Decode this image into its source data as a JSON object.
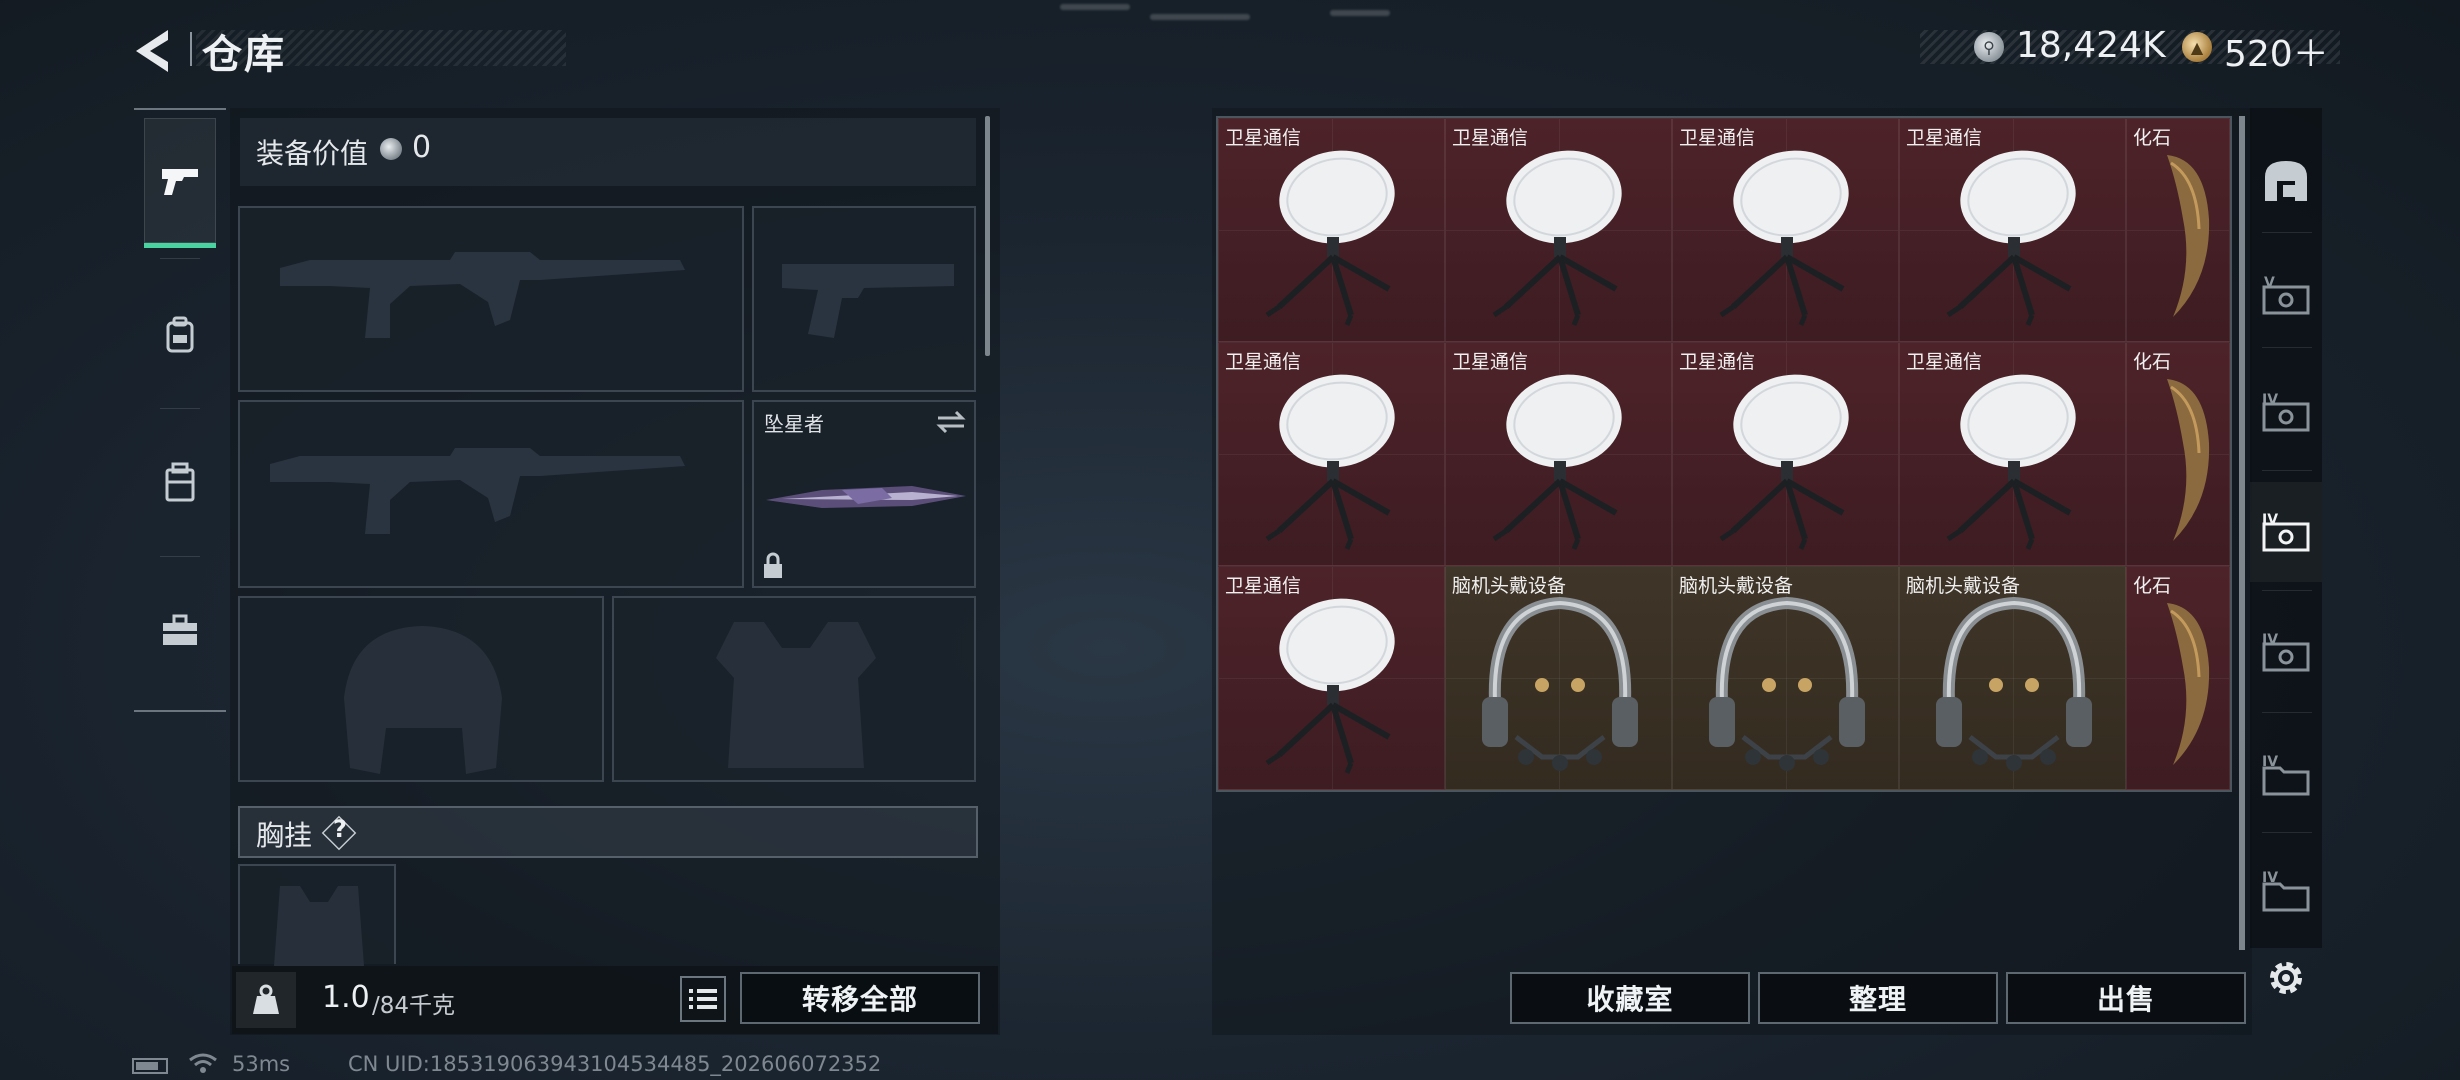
{
  "header": {
    "title": "仓库",
    "currency": {
      "silver_amount": "18,424K",
      "gold_amount": "520＋"
    }
  },
  "loadout": {
    "equip_value_label": "装备价值",
    "equip_value": "0",
    "melee_name": "坠星者",
    "vest_label": "胸挂",
    "vest_help": "?",
    "weight_current": "1.0",
    "weight_max": "/84千克",
    "transfer_all_label": "转移全部"
  },
  "storage": {
    "rows": [
      [
        {
          "name": "卫星通信",
          "type": "dish",
          "tint": "red"
        },
        {
          "name": "卫星通信",
          "type": "dish",
          "tint": "red"
        },
        {
          "name": "卫星通信",
          "type": "dish",
          "tint": "red"
        },
        {
          "name": "卫星通信",
          "type": "dish",
          "tint": "red"
        },
        {
          "name": "化石",
          "type": "claw",
          "tint": "red"
        }
      ],
      [
        {
          "name": "卫星通信",
          "type": "dish",
          "tint": "red"
        },
        {
          "name": "卫星通信",
          "type": "dish",
          "tint": "red"
        },
        {
          "name": "卫星通信",
          "type": "dish",
          "tint": "red"
        },
        {
          "name": "卫星通信",
          "type": "dish",
          "tint": "red"
        },
        {
          "name": "化石",
          "type": "claw",
          "tint": "red"
        }
      ],
      [
        {
          "name": "卫星通信",
          "type": "dish",
          "tint": "red"
        },
        {
          "name": "脑机头戴设备",
          "type": "headset",
          "tint": "brown"
        },
        {
          "name": "脑机头戴设备",
          "type": "headset",
          "tint": "brown"
        },
        {
          "name": "脑机头戴设备",
          "type": "headset",
          "tint": "brown"
        },
        {
          "name": "化石",
          "type": "claw",
          "tint": "red"
        }
      ]
    ],
    "buttons": {
      "collection": "收藏室",
      "sort": "整理",
      "sell": "出售"
    },
    "tabs": [
      "storage-home-icon",
      "storage-tab-V",
      "storage-tab-IV",
      "storage-tab-IV-active",
      "storage-tab-IV",
      "storage-tab-IV-folder",
      "storage-tab-IV-folder"
    ]
  },
  "status": {
    "ping": "53ms",
    "uid": "CN UID:185319063943104534485_202606072352"
  },
  "colors": {
    "accent_green": "#49d3a1",
    "cell_red": "#4d2329",
    "cell_brown": "#3f3528"
  }
}
